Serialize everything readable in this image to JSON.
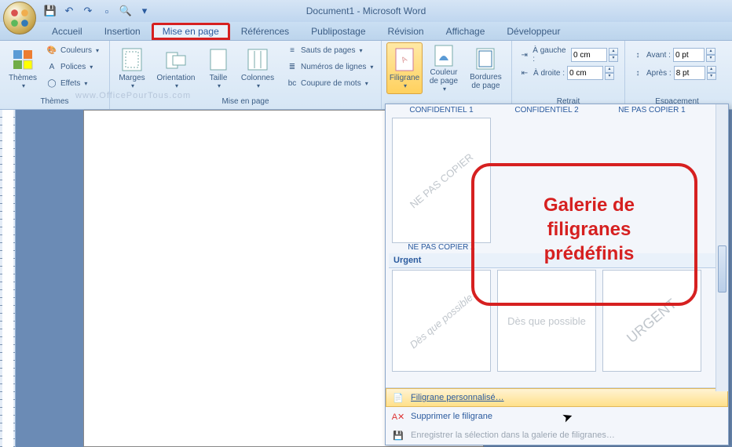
{
  "app": {
    "title": "Document1 - Microsoft Word"
  },
  "tabs": {
    "home": "Accueil",
    "insert": "Insertion",
    "layout": "Mise en page",
    "references": "Références",
    "mailings": "Publipostage",
    "review": "Révision",
    "view": "Affichage",
    "developer": "Développeur"
  },
  "ribbon": {
    "themes": {
      "label": "Thèmes",
      "themes_btn": "Thèmes",
      "colors": "Couleurs",
      "fonts": "Polices",
      "effects": "Effets"
    },
    "page_setup": {
      "label": "Mise en page",
      "margins": "Marges",
      "orientation": "Orientation",
      "size": "Taille",
      "columns": "Colonnes",
      "breaks": "Sauts de pages",
      "line_numbers": "Numéros de lignes",
      "hyphenation": "Coupure de mots"
    },
    "background": {
      "watermark": "Filigrane",
      "page_color": "Couleur de page",
      "page_borders": "Bordures de page"
    },
    "indent": {
      "label": "Retrait",
      "left_label": "À gauche :",
      "right_label": "À droite :",
      "left_val": "0 cm",
      "right_val": "0 cm"
    },
    "spacing": {
      "label": "Espacement",
      "before_label": "Avant :",
      "after_label": "Après :",
      "before_val": "0 pt",
      "after_val": "8 pt"
    }
  },
  "gallery": {
    "row1_labels": {
      "a": "CONFIDENTIEL 1",
      "b": "CONFIDENTIEL 2",
      "c": "NE PAS COPIER 1"
    },
    "nepas_thumb": "NE PAS COPIER",
    "nepas_label": "NE PAS COPIER 2",
    "cat_urgent": "Urgent",
    "urgent_thumbs": {
      "a": "Dès que possible",
      "b": "Dès que possible",
      "c": "URGENT"
    },
    "menu": {
      "custom": "Filigrane personnalisé…",
      "remove": "Supprimer le filigrane",
      "save": "Enregistrer la sélection dans la galerie de filigranes…"
    }
  },
  "annotation": {
    "text_l1": "Galerie de",
    "text_l2": "filigranes",
    "text_l3": "prédéfinis"
  },
  "watermark_url": "www.OfficePourTous.com"
}
